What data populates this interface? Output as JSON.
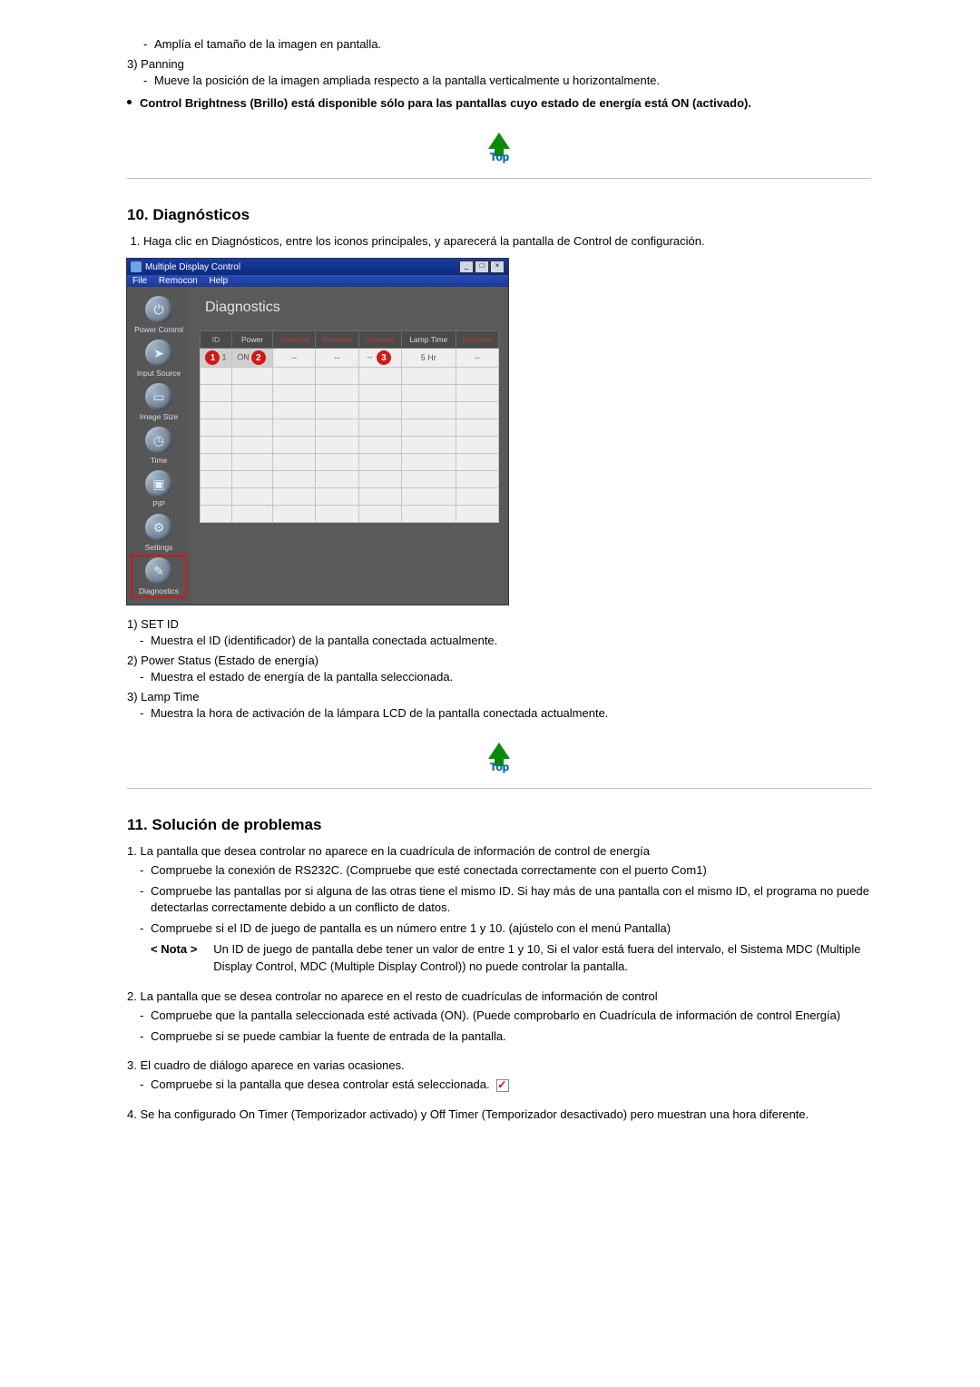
{
  "intro": {
    "i1": "Amplía el tamaño de la imagen en pantalla.",
    "panning_title": "Panning",
    "panning_desc": "Mueve la posición de la imagen ampliada respecto a la pantalla verticalmente u horizontalmente.",
    "brightness_note": "Control Brightness (Brillo) está disponible sólo para las pantallas cuyo estado de energía está ON (activado)."
  },
  "top_label": "Top",
  "diag": {
    "heading": "10. Diagnósticos",
    "step1": "Haga clic en Diagnósticos, entre los iconos principales, y aparecerá la pantalla de Control de configuración.",
    "list1_title": "SET ID",
    "list1_desc": "Muestra el ID (identificador) de la pantalla conectada actualmente.",
    "list2_title": "Power Status (Estado de energía)",
    "list2_desc": "Muestra el estado de energía de la pantalla seleccionada.",
    "list3_title": "Lamp Time",
    "list3_desc": "Muestra la hora de activación de la lámpara LCD de la pantalla conectada actualmente."
  },
  "app": {
    "title": "Multiple Display Control",
    "menu": {
      "file": "File",
      "remocon": "Remocon",
      "help": "Help"
    },
    "main_title": "Diagnostics",
    "sidebar": [
      {
        "label": "Power Control",
        "glyph": "⏻"
      },
      {
        "label": "Input Source",
        "glyph": "➤"
      },
      {
        "label": "Image Size",
        "glyph": "▭"
      },
      {
        "label": "Time",
        "glyph": "◷"
      },
      {
        "label": "PIP",
        "glyph": "▣"
      },
      {
        "label": "Settings",
        "glyph": "⚙"
      },
      {
        "label": "Diagnostics",
        "glyph": "✎"
      }
    ],
    "headers": {
      "id": "ID",
      "power": "Power",
      "r1": "Resered",
      "r2": "Resered",
      "r3": "Resered",
      "lamp": "Lamp Time",
      "r4": "Resered"
    },
    "row": {
      "id": "1",
      "power": "ON",
      "r1": "--",
      "r2": "--",
      "r3": "--",
      "lamp": "5 Hr",
      "r4": "--"
    },
    "badges": {
      "b1": "1",
      "b2": "2",
      "b3": "3"
    }
  },
  "trouble": {
    "heading": "11. Solución de problemas",
    "p1": "La pantalla que desea controlar no aparece en la cuadrícula de información de control de energía",
    "p1_d1": "Compruebe la conexión de RS232C. (Compruebe que esté conectada correctamente con el puerto Com1)",
    "p1_d2": "Compruebe las pantallas por si alguna de las otras tiene el mismo ID. Si hay más de una pantalla con el mismo ID, el programa no puede detectarlas correctamente debido a un conflicto de datos.",
    "p1_d3": "Compruebe si el ID de juego de pantalla es un número entre 1 y 10. (ajústelo con el menú Pantalla)",
    "note_label": "< Nota >",
    "note_text": "Un ID de juego de pantalla debe tener un valor de entre 1 y 10, Si el valor está fuera del intervalo, el Sistema MDC (Multiple Display Control, MDC (Multiple Display Control)) no puede controlar la pantalla.",
    "p2": "La pantalla que se desea controlar no aparece en el resto de cuadrículas de información de control",
    "p2_d1": "Compruebe que la pantalla seleccionada esté activada (ON). (Puede comprobarlo en Cuadrícula de información de control Energía)",
    "p2_d2": "Compruebe si se puede cambiar la fuente de entrada de la pantalla.",
    "p3": "El cuadro de diálogo aparece en varias ocasiones.",
    "p3_d1": "Compruebe si la pantalla que desea controlar está seleccionada.",
    "p4": "Se ha configurado On Timer (Temporizador activado) y Off Timer (Temporizador desactivado) pero muestran una hora diferente."
  }
}
